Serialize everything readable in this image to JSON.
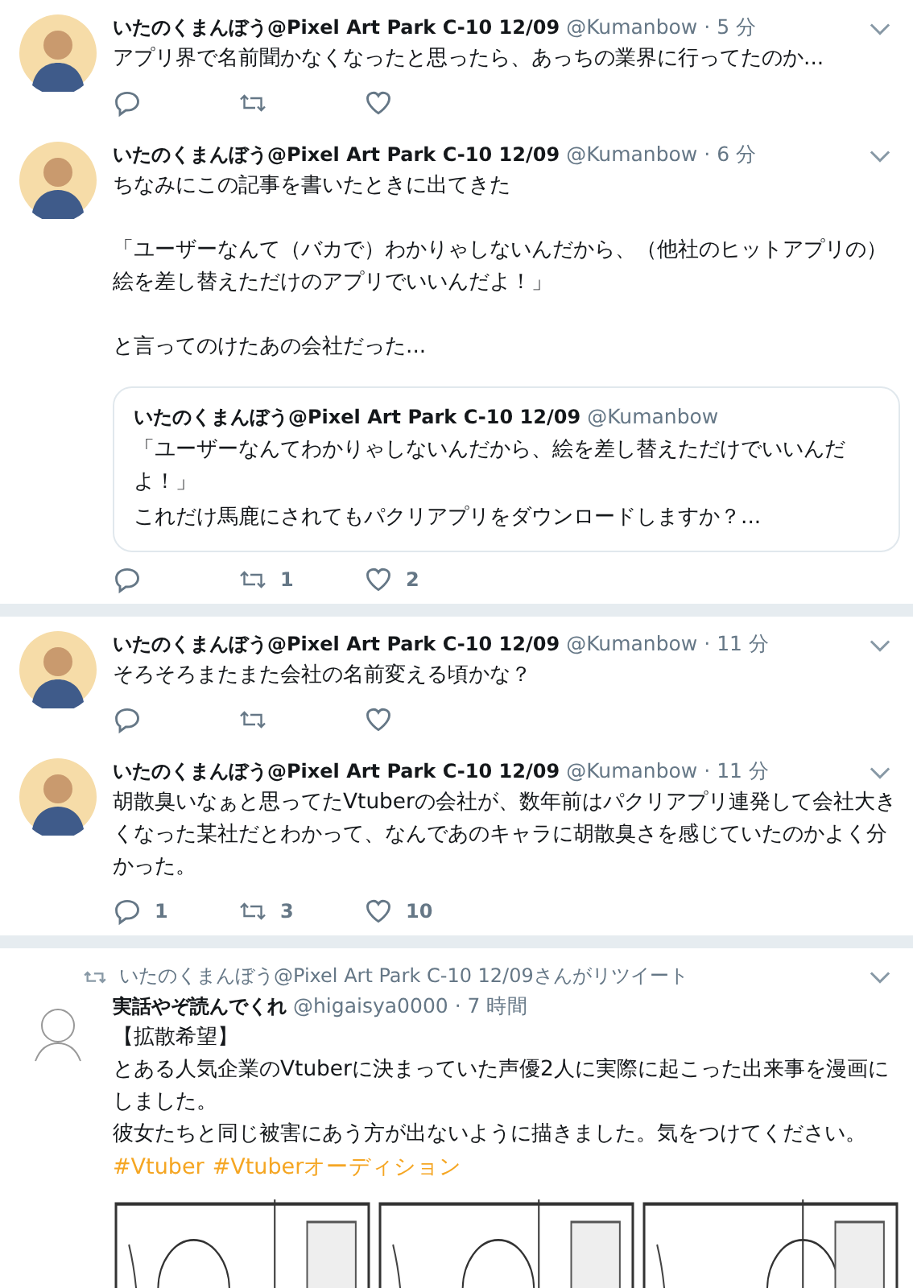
{
  "threads": [
    {
      "tweets": [
        {
          "avatar": {
            "kind": "pixel"
          },
          "name": "いたのくまんぼう@Pixel Art Park C-10 12/09",
          "handle": "@Kumanbow",
          "time": "· 5 分",
          "paragraphs": [
            [
              "アプリ界で名前聞かなくなったと思ったら、あっちの業界に行ってたのか..."
            ]
          ]
        },
        {
          "avatar": {
            "kind": "pixel"
          },
          "name": "いたのくまんぼう@Pixel Art Park C-10 12/09",
          "handle": "@Kumanbow",
          "time": "· 6 分",
          "paragraphs": [
            [
              "ちなみにこの記事を書いたときに出てきた"
            ],
            [
              "「ユーザーなんて（バカで）わかりゃしないんだから、（他社のヒットアプリの）絵を差し替えただけのアプリでいいんだよ！」"
            ],
            [
              "と言ってのけたあの会社だった..."
            ]
          ],
          "quote": {
            "name": "いたのくまんぼう@Pixel Art Park C-10 12/09",
            "handle": "@Kumanbow",
            "lines": [
              "「ユーザーなんてわかりゃしないんだから、絵を差し替えただけでいいんだよ！」",
              "これだけ馬鹿にされてもパクリアプリをダウンロードしますか？..."
            ]
          },
          "retweets": "1",
          "likes": "2"
        }
      ]
    },
    {
      "tweets": [
        {
          "avatar": {
            "kind": "pixel"
          },
          "name": "いたのくまんぼう@Pixel Art Park C-10 12/09",
          "handle": "@Kumanbow",
          "time": "· 11 分",
          "paragraphs": [
            [
              "そろそろまたまた会社の名前変える頃かな？"
            ]
          ]
        },
        {
          "avatar": {
            "kind": "pixel"
          },
          "name": "いたのくまんぼう@Pixel Art Park C-10 12/09",
          "handle": "@Kumanbow",
          "time": "· 11 分",
          "paragraphs": [
            [
              "胡散臭いなぁと思ってたVtuberの会社が、数年前はパクリアプリ連発して会社大きくなった某社だとわかって、なんであのキャラに胡散臭さを感じていたのかよく分かった。"
            ]
          ],
          "replies": "1",
          "retweets": "3",
          "likes": "10"
        }
      ]
    },
    {
      "tweets": [
        {
          "avatar": {
            "kind": "sketch"
          },
          "retweeted_by": "いたのくまんぼう@Pixel Art Park C-10 12/09さんがリツイート",
          "name": "実話やぞ読んでくれ",
          "handle": "@higaisya0000",
          "time": "· 7 時間",
          "paragraphs": [
            [
              "【拡散希望】",
              "とある人気企業のVtuberに決まっていた声優2人に実際に起こった出来事を漫画にしました。",
              "彼女たちと同じ被害にあう方が出ないように描きました。気をつけてください。"
            ]
          ],
          "hashtags": [
            "#Vtuber",
            "#Vtuberオーディション"
          ],
          "media": [
            {
              "kind": "picture"
            },
            {
              "kind": "picture"
            },
            {
              "kind": "picture"
            }
          ]
        }
      ]
    }
  ]
}
